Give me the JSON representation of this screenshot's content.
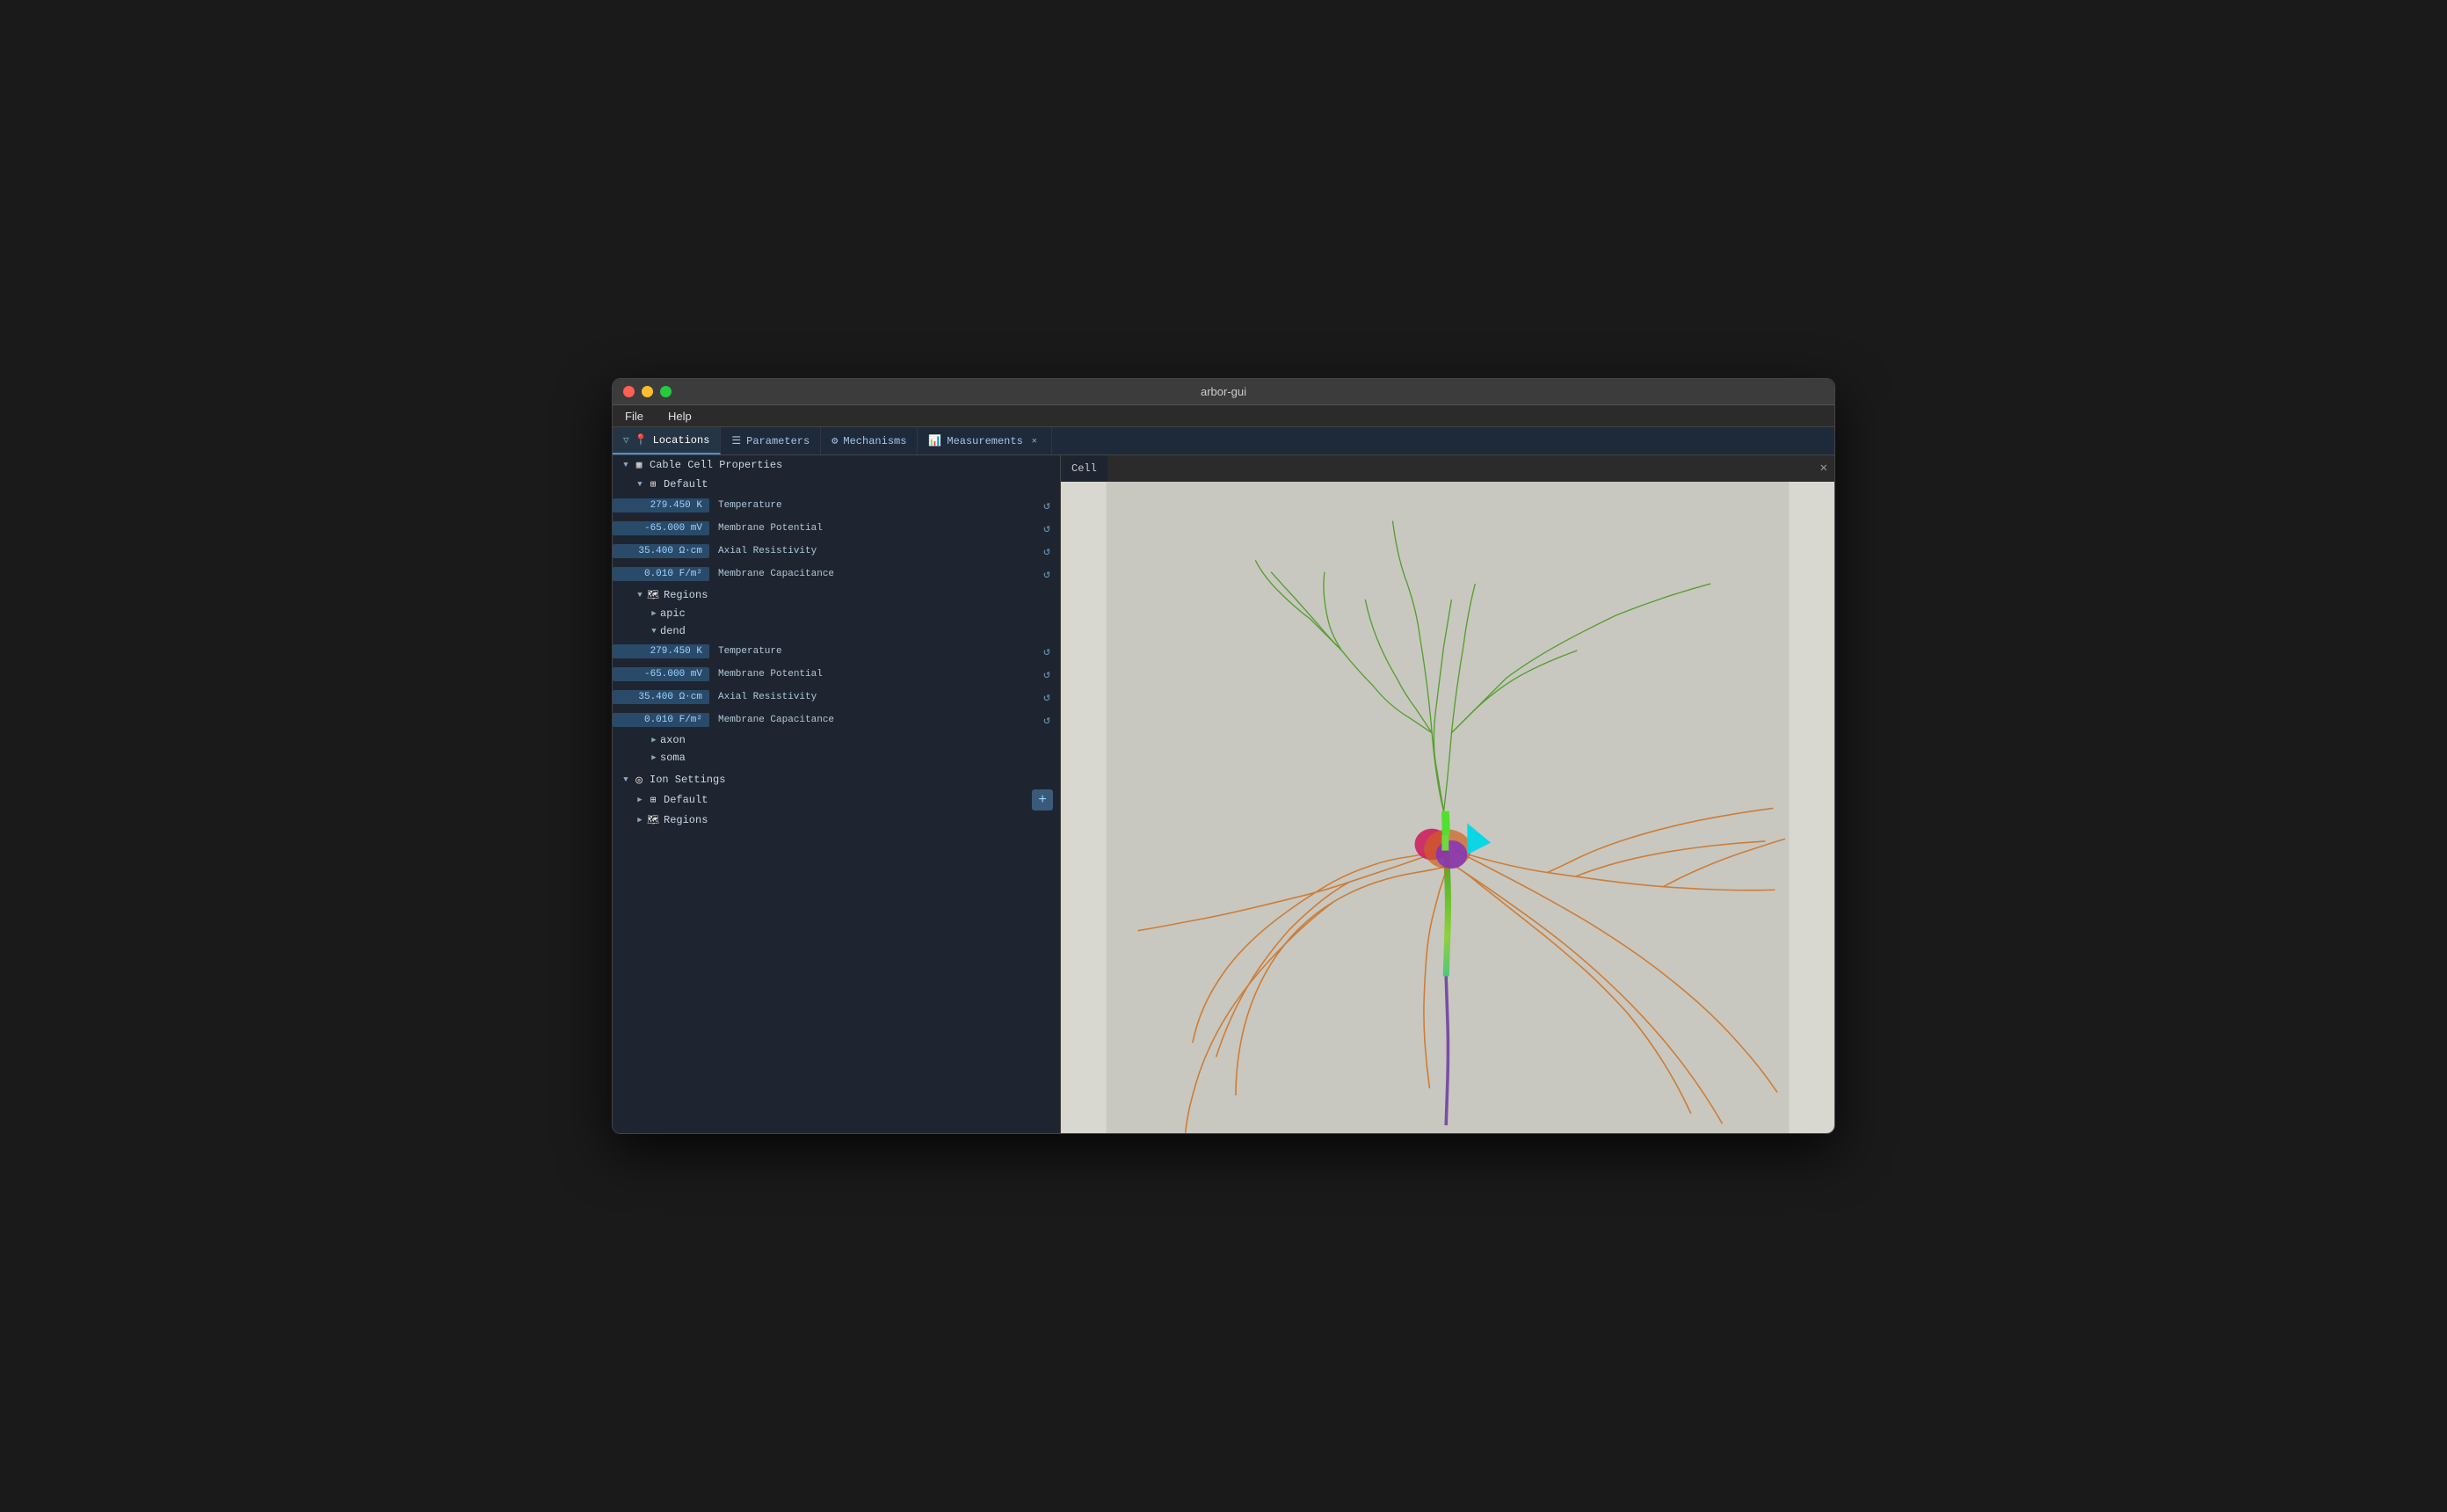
{
  "window": {
    "title": "arbor-gui"
  },
  "menu": {
    "items": [
      "File",
      "Help"
    ]
  },
  "tabs": [
    {
      "id": "locations",
      "label": "Locations",
      "icon": "📍",
      "active": true,
      "closeable": false
    },
    {
      "id": "parameters",
      "label": "Parameters",
      "icon": "≡",
      "active": false,
      "closeable": false
    },
    {
      "id": "mechanisms",
      "label": "Mechanisms",
      "icon": "⚙",
      "active": false,
      "closeable": false
    },
    {
      "id": "measurements",
      "label": "Measurements",
      "icon": "📊",
      "active": false,
      "closeable": true
    }
  ],
  "cell_tab": {
    "label": "Cell",
    "icon": "□"
  },
  "tree": {
    "cable_cell_properties": {
      "label": "Cable Cell Properties",
      "default": {
        "label": "Default",
        "properties": [
          {
            "value": "279.450 K",
            "name": "Temperature"
          },
          {
            "value": "-65.000 mV",
            "name": "Membrane Potential"
          },
          {
            "value": "35.400 Ω·cm",
            "name": "Axial Resistivity"
          },
          {
            "value": "0.010 F/m²",
            "name": "Membrane Capacitance"
          }
        ]
      },
      "regions": {
        "label": "Regions",
        "items": [
          {
            "name": "apic",
            "expanded": false,
            "properties": []
          },
          {
            "name": "dend",
            "expanded": true,
            "properties": [
              {
                "value": "279.450 K",
                "name": "Temperature"
              },
              {
                "value": "-65.000 mV",
                "name": "Membrane Potential"
              },
              {
                "value": "35.400 Ω·cm",
                "name": "Axial Resistivity"
              },
              {
                "value": "0.010 F/m²",
                "name": "Membrane Capacitance"
              }
            ]
          },
          {
            "name": "axon",
            "expanded": false,
            "properties": []
          },
          {
            "name": "soma",
            "expanded": false,
            "properties": []
          }
        ]
      }
    },
    "ion_settings": {
      "label": "Ion Settings",
      "default": {
        "label": "Default"
      },
      "regions": {
        "label": "Regions"
      }
    }
  },
  "icons": {
    "reset": "↺",
    "add": "+",
    "close": "✕",
    "filter": "▽"
  }
}
